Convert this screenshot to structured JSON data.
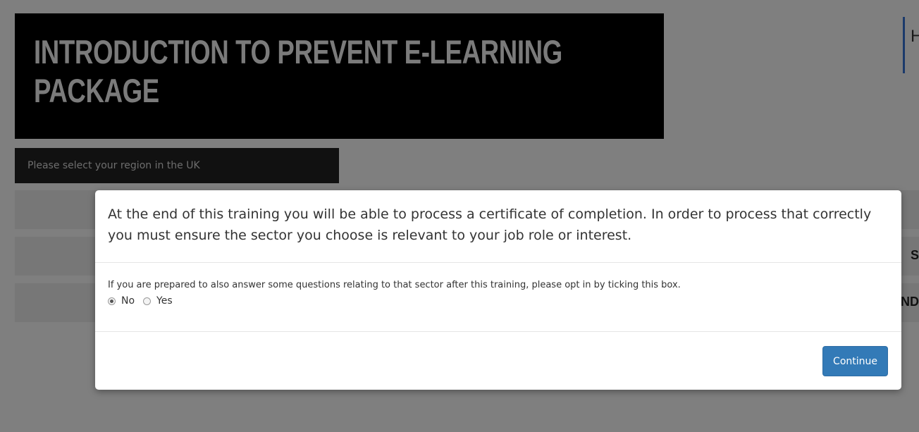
{
  "page": {
    "title": "INTRODUCTION TO PREVENT E-LEARNING PACKAGE",
    "logo_text": "H",
    "region_select": {
      "placeholder": "Please select your region in the UK"
    },
    "sector_rows": [
      {
        "edge_text": ""
      },
      {
        "edge_text": "S"
      },
      {
        "edge_text": "ND"
      }
    ]
  },
  "modal": {
    "header_text": "At the end of this training you will be able to process a certificate of completion. In order to process that correctly you must ensure the sector you choose is relevant to your job role or interest.",
    "question": "If you are prepared to also answer some questions relating to that sector after this training, please opt in by ticking this box.",
    "options": [
      {
        "label": "No",
        "checked": true
      },
      {
        "label": "Yes",
        "checked": false
      }
    ],
    "continue_label": "Continue"
  },
  "colors": {
    "overlay": "#7f7f7f",
    "banner_bg": "#000000",
    "title_text": "#7b7b7b",
    "button_primary": "#337ab7",
    "logo_bar": "#1b3a6b"
  }
}
